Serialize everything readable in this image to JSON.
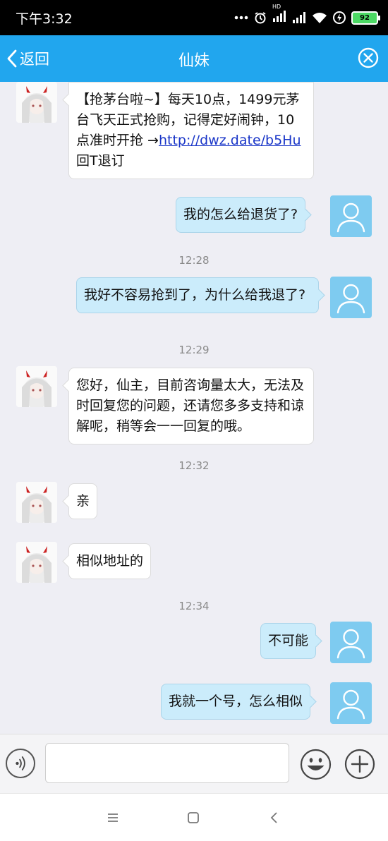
{
  "status_bar": {
    "time": "下午3:32",
    "battery": "92",
    "network_badge": "HD"
  },
  "header": {
    "back_label": "返回",
    "title": "仙妹"
  },
  "messages": [
    {
      "side": "left",
      "text_parts": [
        "【抢茅台啦~】每天10点，1499元茅台飞天正式抢购，记得定好闹钟，10点准时开抢 →",
        "http://dwz.date/b5Hu",
        " 回T退订"
      ]
    },
    {
      "side": "right",
      "text": "我的怎么给退货了?"
    },
    {
      "time": "12:28"
    },
    {
      "side": "right",
      "text": "我好不容易抢到了，为什么给我退了?"
    },
    {
      "time": "12:29"
    },
    {
      "side": "left",
      "text": "您好，仙主，目前咨询量太大，无法及时回复您的问题，还请您多多支持和谅解呢，稍等会一一回复的哦。"
    },
    {
      "time": "12:32"
    },
    {
      "side": "left",
      "text": "亲"
    },
    {
      "side": "left",
      "text": "相似地址的"
    },
    {
      "time": "12:34"
    },
    {
      "side": "right",
      "text": "不可能"
    },
    {
      "side": "right",
      "text": "我就一个号，怎么相似"
    }
  ],
  "input": {
    "value": "",
    "placeholder": ""
  },
  "colors": {
    "header": "#21a6ee",
    "bubble_right": "#cbecfb",
    "bubble_left": "#ffffff",
    "avatar_self": "#7ecbf0",
    "chat_bg": "#eeeef4",
    "link": "#1a36c8"
  },
  "icons": [
    "back-chevron-icon",
    "close-circle-icon",
    "voice-icon",
    "emoji-icon",
    "plus-icon",
    "user-avatar-icon",
    "menu-icon",
    "home-icon",
    "back-icon"
  ]
}
